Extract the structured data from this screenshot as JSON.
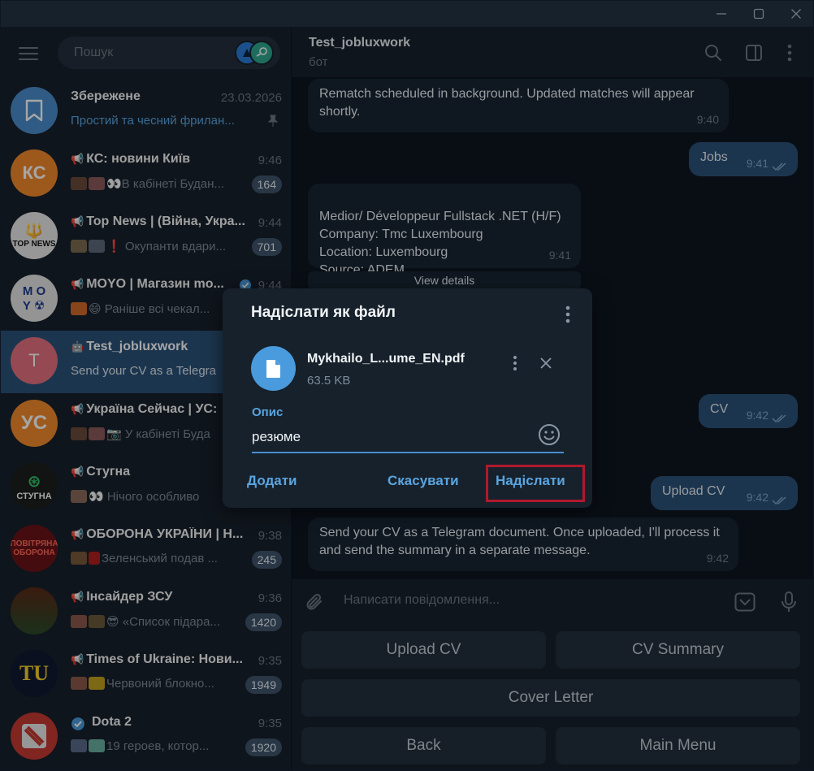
{
  "window": {
    "controls": [
      "minimize",
      "maximize",
      "close"
    ]
  },
  "sidebar": {
    "search_placeholder": "Пошук",
    "chats": [
      {
        "title": "Збережене",
        "time": "23.03.2026",
        "preview": "Простий та чесний фрилан...",
        "is_channel": false,
        "pinned": true,
        "avatar_color": "#4b8dcc"
      },
      {
        "title": "КС: новини Київ",
        "time": "9:46",
        "preview": "👀В кабінеті Будан...",
        "is_channel": true,
        "unread": "164",
        "avatar_color": "#f1892c"
      },
      {
        "title": "Top News | (Війна, Укра...",
        "time": "9:44",
        "preview": "❗ Окупанти вдари...",
        "is_channel": true,
        "unread": "701",
        "avatar_color": "#e9e9e9"
      },
      {
        "title": "MOYO | Магазин mo...",
        "time": "9:44",
        "preview": "😄 Раніше всі чекал...",
        "is_channel": true,
        "verified": true,
        "avatar_color": "#e4e4e4"
      },
      {
        "title": "Test_jobluxwork",
        "time": "",
        "preview": "Send your CV as a Telegra",
        "is_bot": true,
        "active": true,
        "avatar_letter": "T",
        "avatar_color": "#e5707f"
      },
      {
        "title": "Україна Сейчас | УС:",
        "time": "",
        "preview": "📷 У кабінеті Буда",
        "is_channel": true,
        "avatar_color": "#f28a2c"
      },
      {
        "title": "Стугна",
        "time": "",
        "preview": "👀 Нічого особливо",
        "is_channel": true,
        "avatar_color": "#1b1f1c"
      },
      {
        "title": "ОБОРОНА УКРАЇНИ | Н...",
        "time": "9:38",
        "preview": "Зеленський подав ...",
        "is_channel": true,
        "unread": "245",
        "avatar_color": "#6b1318"
      },
      {
        "title": "Інсайдер ЗСУ",
        "time": "9:36",
        "preview": "😎 «Список підара...",
        "is_channel": true,
        "unread": "1420",
        "avatar_color": "#3a2a1d"
      },
      {
        "title": "Times of Ukraine: Нови...",
        "time": "9:35",
        "preview": "Червоний блокно...",
        "is_channel": true,
        "unread": "1949",
        "avatar_color": "#101a30"
      },
      {
        "title": "Dota 2",
        "time": "9:35",
        "preview": "19 героев, котор...",
        "is_channel": false,
        "verified": true,
        "unread": "1920",
        "avatar_color": "#c53a32"
      }
    ]
  },
  "header": {
    "title": "Test_jobluxwork",
    "subtitle": "бот"
  },
  "messages": [
    {
      "dir": "in",
      "text": "Rematch scheduled in background. Updated matches will appear shortly.",
      "time": "9:40"
    },
    {
      "dir": "out",
      "text": "Jobs",
      "time": "9:41"
    },
    {
      "dir": "in",
      "text": "Medior/ Développeur Fullstack .NET (H/F)\nCompany: Tmc Luxembourg\nLocation: Luxembourg\nSource: ADEM",
      "time": "9:41"
    },
    {
      "dir": "inline_button",
      "text": "View details"
    },
    {
      "dir": "out",
      "text": "CV",
      "time": "9:42"
    },
    {
      "dir": "out",
      "text": "Upload CV",
      "time": "9:42"
    },
    {
      "dir": "in",
      "text": "Send your CV as a Telegram document. Once uploaded, I'll process it and send the summary in a separate message.",
      "time": "9:42"
    }
  ],
  "composer": {
    "placeholder": "Написати повідомлення..."
  },
  "reply_keyboard": {
    "upload_cv": "Upload CV",
    "cv_summary": "CV Summary",
    "cover_letter": "Cover Letter",
    "back": "Back",
    "main_menu": "Main Menu"
  },
  "dialog": {
    "title": "Надіслати як файл",
    "file_name": "Mykhailo_L...ume_EN.pdf",
    "file_size": "63.5 KB",
    "caption_label": "Опис",
    "caption_value": "резюме",
    "add_button": "Додати",
    "cancel_button": "Скасувати",
    "send_button": "Надіслати",
    "highlight_color": "#b0192c"
  },
  "colors": {
    "accent": "#5aa5e0",
    "bubble_out": "#2b5278",
    "bubble_in": "#182533",
    "background": "#0e1621",
    "panel": "#17212b"
  }
}
